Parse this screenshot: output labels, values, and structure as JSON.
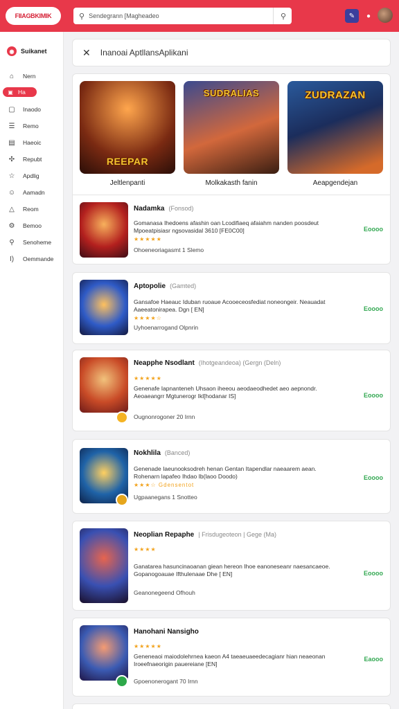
{
  "header": {
    "logo_text": "FIIAGBKIMIK",
    "search_placeholder": "Sendegrann  [Magheadeo",
    "brand_color": "#e8384a"
  },
  "sidebar": {
    "brand": "Suikanet",
    "items": [
      {
        "label": "Nern",
        "icon": "home-icon"
      },
      {
        "label": "Ha",
        "icon": "grid-icon",
        "active": true
      },
      {
        "label": "Inaodo",
        "icon": "doc-icon"
      },
      {
        "label": "Remo",
        "icon": "list-icon"
      },
      {
        "label": "Haeoic",
        "icon": "note-icon"
      },
      {
        "label": "Repubt",
        "icon": "puzzle-icon"
      },
      {
        "label": "Apdlig",
        "icon": "star-icon"
      },
      {
        "label": "Aamadn",
        "icon": "chat-icon"
      },
      {
        "label": "Reom",
        "icon": "triangle-icon"
      },
      {
        "label": "Bemoo",
        "icon": "gear-icon"
      },
      {
        "label": "Senoheme",
        "icon": "link-icon"
      },
      {
        "label": "Oemmande",
        "icon": "bracket-icon"
      }
    ]
  },
  "main": {
    "title": "Inanoai  AptllansAplikani",
    "featured": [
      {
        "caption": "Jeltlenpanti",
        "art_text": "REEPAR",
        "art_sub": "NENDIAIN"
      },
      {
        "caption": "Molkakasth fanin",
        "art_text": "SUDRALIAS",
        "art_sub": ""
      },
      {
        "caption": "Aeapgendejan",
        "art_text": "ZUDRAZAN",
        "art_sub": ""
      }
    ],
    "list": [
      {
        "name": "Nadamka",
        "sub": "(Fonsod)",
        "desc": "Gomanasa Ihedoens afashin oan  Lcodifiaeq afaiahm nanden poosdeut  Mpoeatpisiasr ngsovasidal 3610 [FE0C00]",
        "stars": "★★★★★",
        "meta": "Ohoeneoriagasmt 1 Slemo",
        "action": "Eoooo"
      },
      {
        "name": "Aptopolie",
        "sub": "(Gamted)",
        "desc": "Gansafoe Haeauc Iduban ruoaue  Acooeceosfediat noneongeir.  Neauadat Aaeeatonirapea. Dgn  [ EN]",
        "stars": "★★★★☆",
        "meta": "Uyhoenarrogand  Olpnrin",
        "action": "Eoooo"
      },
      {
        "name": "Neapphe Nsodlant",
        "sub": "(Ihotgeandeoa) (Gergn (Deln)",
        "desc": "Genenafe Iapnanteneh Uhsaon iheeou  aeodaeodhedet aeo aepnondr.  Aeoaeangrr Mgtunerogr Ikl[hodanar IS]  ",
        "stars": "★★★★★",
        "meta": "Ougnonrogoner 20 Irnn",
        "action": "Eoooo"
      },
      {
        "name": "Nokhlila",
        "sub": "(Banced)",
        "desc": "Genenade Iaeunooksodreh henan  Gentan Itapendlar naeaarem aean.  Rohenarn lapafeo Ihdao Ib(laoo Doodo)",
        "stars": "★★★☆ Gdensentot",
        "meta": "Ugpaanegans 1 Snotteo",
        "action": "Eoooo"
      },
      {
        "name": "Neoplian  Repaphe",
        "sub": "| Frisdugeoteon | Gege (Ma)",
        "desc": "Ganatarea hasuncinaoanan giean hereon  Ihoe eanoneseanr naesancaeoe.  Gopanogoauae Ifthulenaae Dhe [ EN]",
        "stars": "★★★★",
        "meta": "Geanonegeend  Ofhouh",
        "action": "Eoooo"
      },
      {
        "name": "Hanohani  Nansigho",
        "sub": "",
        "desc": "Geneneaoi maiodolehrnea kaeon  A4 taeaeuaeedecagianr hian neaeonan  Iroeefnaeorigin pauereiane  [EN]",
        "stars": "★★★★★",
        "meta": "Gpoenonerogant 70 Irnn",
        "action": "Eaooo"
      }
    ]
  }
}
